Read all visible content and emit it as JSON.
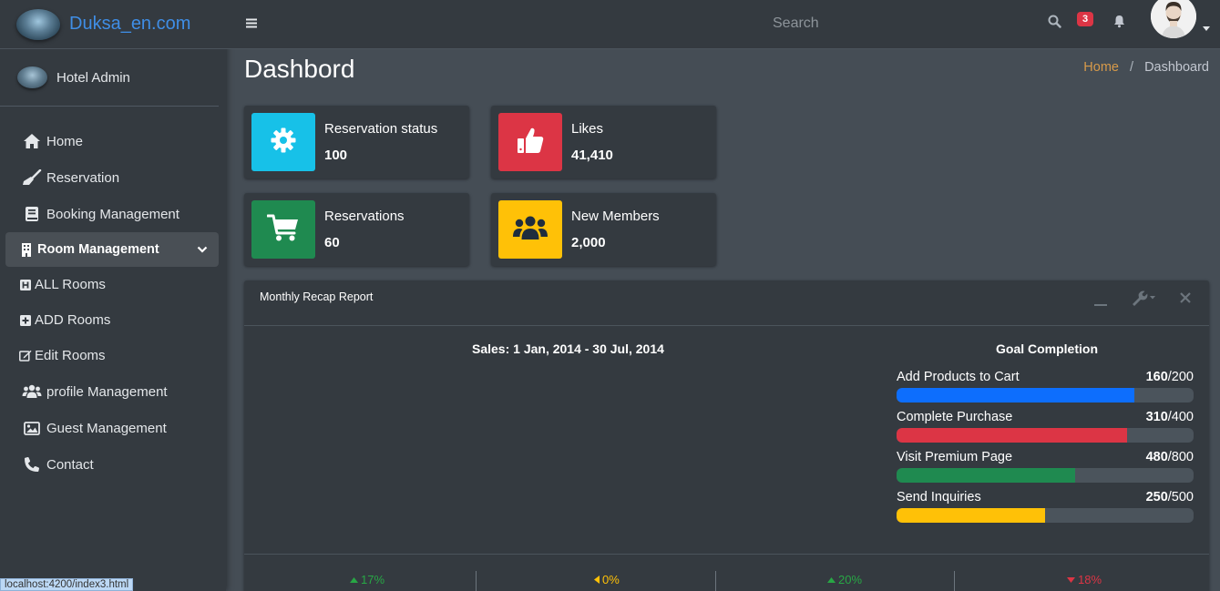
{
  "brand": {
    "name": "Duksa_en.com"
  },
  "user": {
    "name": "Hotel Admin"
  },
  "sidebar": {
    "items": [
      {
        "label": "Home",
        "icon": "home-icon"
      },
      {
        "label": "Reservation",
        "icon": "broom-icon"
      },
      {
        "label": "Booking Management",
        "icon": "book-icon"
      },
      {
        "label": "Room Management",
        "icon": "building-icon"
      },
      {
        "label": "ALL Rooms",
        "icon": "hotel-h-icon"
      },
      {
        "label": "ADD Rooms",
        "icon": "plus-square-icon"
      },
      {
        "label": "Edit Rooms",
        "icon": "edit-icon"
      },
      {
        "label": "profile Management",
        "icon": "users-icon"
      },
      {
        "label": "Guest Management",
        "icon": "image-icon"
      },
      {
        "label": "Contact",
        "icon": "phone-icon"
      }
    ]
  },
  "topbar": {
    "search_placeholder": "Search",
    "message_count": "3"
  },
  "page": {
    "title": "Dashbord",
    "breadcrumb": {
      "home": "Home",
      "separator": "/",
      "current": "Dashboard"
    }
  },
  "info_boxes": [
    {
      "label": "Reservation status",
      "value": "100",
      "color": "#17c1e8",
      "icon": "gear-icon"
    },
    {
      "label": "Likes",
      "value": "41,410",
      "color": "#dc3545",
      "icon": "thumbs-up-icon"
    },
    {
      "label": "Reservations",
      "value": "60",
      "color": "#1f8a50",
      "icon": "cart-icon"
    },
    {
      "label": "New Members",
      "value": "2,000",
      "color": "#ffc107",
      "icon": "users-icon"
    }
  ],
  "report": {
    "title": "Monthly Recap Report",
    "chart_title": "Sales: 1 Jan, 2014 - 30 Jul, 2014",
    "goal_title": "Goal Completion",
    "goals": [
      {
        "label": "Add Products to Cart",
        "value": "160",
        "total": "/200",
        "progress": 0.8,
        "color": "#0d6efd"
      },
      {
        "label": "Complete Purchase",
        "value": "310",
        "total": "/400",
        "progress": 0.775,
        "color": "#dc3545"
      },
      {
        "label": "Visit Premium Page",
        "value": "480",
        "total": "/800",
        "progress": 0.6,
        "color": "#1f8a50"
      },
      {
        "label": "Send Inquiries",
        "value": "250",
        "total": "/500",
        "progress": 0.5,
        "color": "#ffc107"
      }
    ],
    "footer": [
      {
        "text": "17%",
        "direction": "up",
        "color": "#28a745"
      },
      {
        "text": "0%",
        "direction": "left",
        "color": "#ffc107"
      },
      {
        "text": "20%",
        "direction": "up",
        "color": "#28a745"
      },
      {
        "text": "18%",
        "direction": "down",
        "color": "#dc3545"
      }
    ]
  },
  "statusbar": {
    "url": "localhost:4200/index3.html"
  }
}
